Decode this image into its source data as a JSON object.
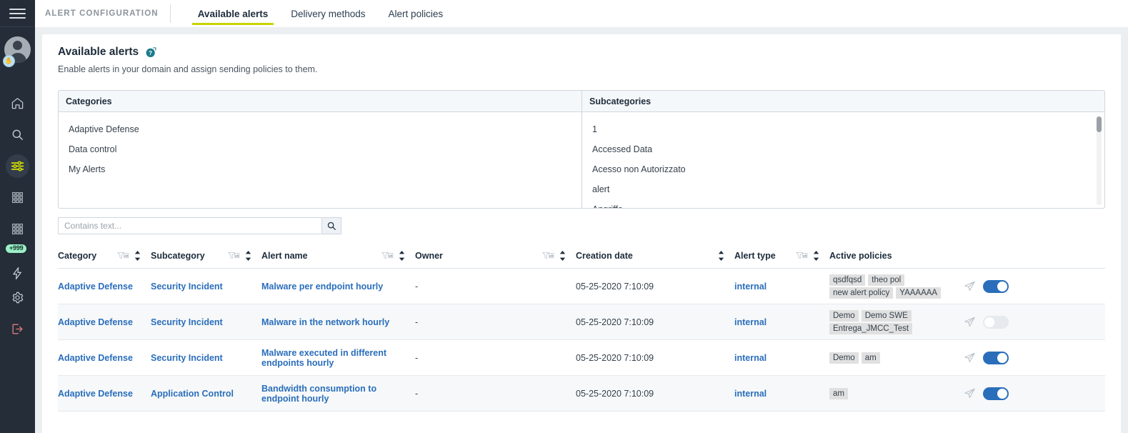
{
  "sidebar": {
    "menu_icon": "hamburger-menu-icon",
    "avatar_badge": "hand-icon",
    "items": [
      {
        "name": "home-icon",
        "badge": null
      },
      {
        "name": "search-icon",
        "badge": null
      },
      {
        "name": "sliders-icon",
        "badge": null
      },
      {
        "name": "grid-icon",
        "badge": null
      },
      {
        "name": "grid-icon",
        "badge": null
      },
      {
        "name": "bolt-icon",
        "badge": "+999"
      },
      {
        "name": "gear-icon",
        "badge": null
      },
      {
        "name": "logout-icon",
        "badge": null
      }
    ]
  },
  "header": {
    "breadcrumb": "ALERT CONFIGURATION",
    "tabs": [
      {
        "label": "Available alerts",
        "active": true
      },
      {
        "label": "Delivery methods",
        "active": false
      },
      {
        "label": "Alert policies",
        "active": false
      }
    ]
  },
  "page": {
    "title": "Available alerts",
    "help_icon": "help-circle-icon",
    "subtitle": "Enable alerts in your domain and assign sending policies to them."
  },
  "panels": {
    "categories": {
      "header": "Categories",
      "items": [
        "Adaptive Defense",
        "Data control",
        "My Alerts"
      ]
    },
    "subcategories": {
      "header": "Subcategories",
      "items": [
        "1",
        "Accessed Data",
        "Acesso non Autorizzato",
        "alert",
        "Angriffe"
      ]
    }
  },
  "search": {
    "placeholder": "Contains text...",
    "value": "",
    "button_icon": "search-icon"
  },
  "table": {
    "columns": [
      {
        "label": "Category",
        "filter": true,
        "sort": true
      },
      {
        "label": "Subcategory",
        "filter": true,
        "sort": true
      },
      {
        "label": "Alert name",
        "filter": true,
        "sort": true
      },
      {
        "label": "Owner",
        "filter": true,
        "sort": true
      },
      {
        "label": "Creation date",
        "filter": false,
        "sort": true
      },
      {
        "label": "Alert type",
        "filter": true,
        "sort": true
      },
      {
        "label": "Active policies",
        "filter": false,
        "sort": false
      }
    ],
    "rows": [
      {
        "category": "Adaptive Defense",
        "subcategory": "Security Incident",
        "alert_name": "Malware per endpoint hourly",
        "owner": "-",
        "creation_date": "05-25-2020 7:10:09",
        "alert_type": "internal",
        "policies": [
          "qsdfqsd",
          "theo pol",
          "new alert policy",
          "YAAAAAA"
        ],
        "send_icon": "send-icon",
        "enabled": true
      },
      {
        "category": "Adaptive Defense",
        "subcategory": "Security Incident",
        "alert_name": "Malware in the network hourly",
        "owner": "-",
        "creation_date": "05-25-2020 7:10:09",
        "alert_type": "internal",
        "policies": [
          "Demo",
          "Demo SWE",
          "Entrega_JMCC_Test"
        ],
        "send_icon": "send-icon",
        "enabled": false
      },
      {
        "category": "Adaptive Defense",
        "subcategory": "Security Incident",
        "alert_name": "Malware executed in different endpoints hourly",
        "owner": "-",
        "creation_date": "05-25-2020 7:10:09",
        "alert_type": "internal",
        "policies": [
          "Demo",
          "am"
        ],
        "send_icon": "send-icon",
        "enabled": true
      },
      {
        "category": "Adaptive Defense",
        "subcategory": "Application Control",
        "alert_name": "Bandwidth consumption to endpoint hourly",
        "owner": "-",
        "creation_date": "05-25-2020 7:10:09",
        "alert_type": "internal",
        "policies": [
          "am"
        ],
        "send_icon": "send-icon",
        "enabled": true
      }
    ]
  },
  "colors": {
    "sidebar_bg": "#242d38",
    "accent_tab": "#c8d400",
    "link": "#2a6ebb",
    "toggle_on": "#2a6ebb",
    "badge_bg": "#9bf0c8",
    "help_icon": "#1b7a8c",
    "logout_icon": "#e07a7a"
  }
}
